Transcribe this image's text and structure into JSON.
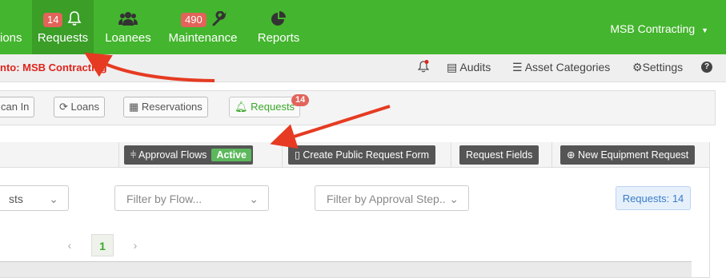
{
  "topnav": {
    "items": [
      {
        "label": "ions",
        "icon": "none"
      },
      {
        "label": "Requests",
        "badge": "14",
        "icon": "bell-icon"
      },
      {
        "label": "Loanees",
        "icon": "users-icon"
      },
      {
        "label": "Maintenance",
        "badge": "490",
        "icon": "wrench-icon"
      },
      {
        "label": "Reports",
        "icon": "pie-chart-icon"
      }
    ],
    "company": "MSB Contracting",
    "colors": {
      "bar": "#44b52e",
      "active": "#3a9e27",
      "badge": "#e2635a"
    }
  },
  "subbar": {
    "org_text": "nto: MSB Contracting",
    "items": [
      "Audits",
      "Asset Categories",
      "Settings"
    ]
  },
  "tabs": {
    "items": [
      "can In",
      "Loans",
      "Reservations",
      "Requests"
    ],
    "requests_badge": "14"
  },
  "toolbar": {
    "approval_flows": "Approval Flows",
    "active": "Active",
    "create_form": "Create Public Request Form",
    "request_fields": "Request Fields",
    "new_request": "New Equipment Request"
  },
  "filters": {
    "status": "sts",
    "flow_placeholder": "Filter by Flow...",
    "step_placeholder": "Filter by Approval Step.."
  },
  "request_count": "Requests: 14",
  "pagination": {
    "prev": "‹",
    "current": "1",
    "next": "›"
  }
}
